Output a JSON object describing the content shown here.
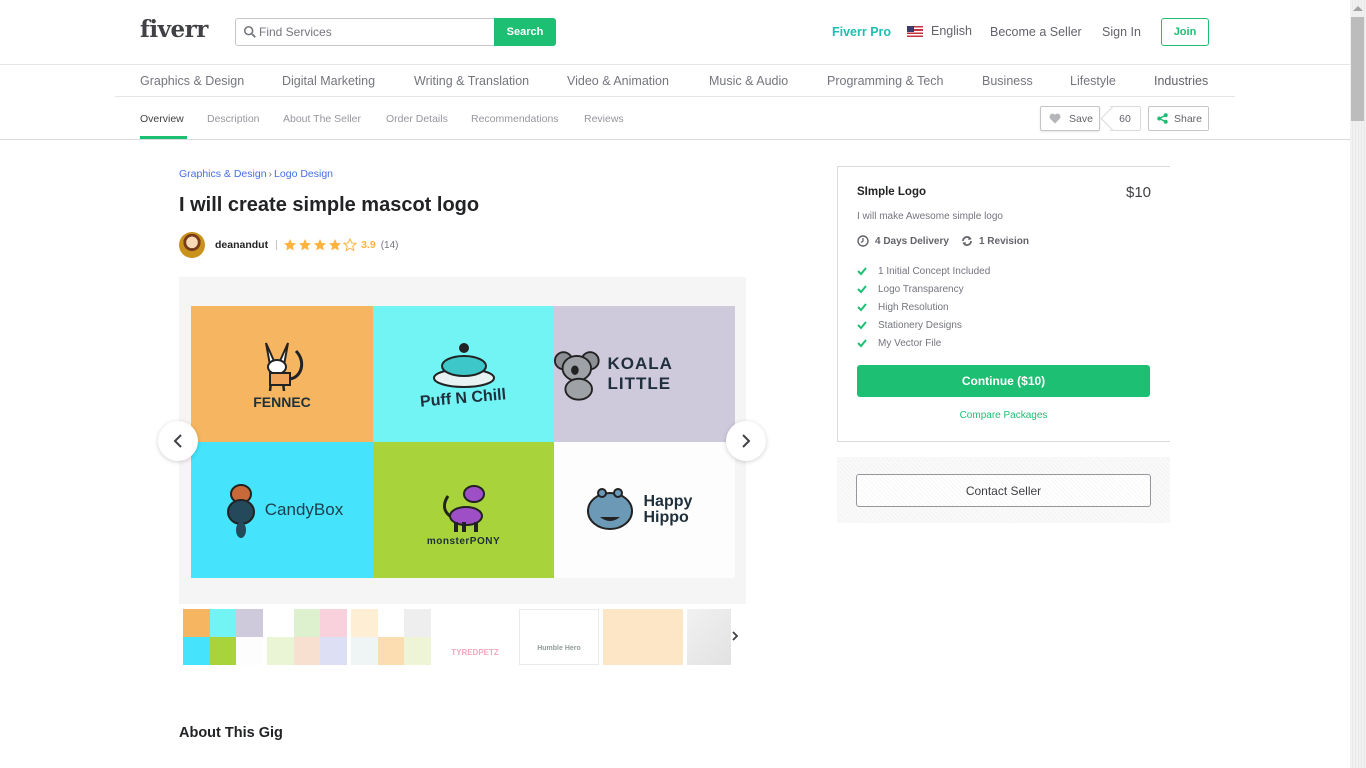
{
  "header": {
    "logo": "fiverr",
    "search_placeholder": "Find Services",
    "search_button": "Search",
    "pro_link": "Fiverr Pro",
    "language": "English",
    "become_seller": "Become a Seller",
    "sign_in": "Sign In",
    "join": "Join"
  },
  "categories": [
    "Graphics & Design",
    "Digital Marketing",
    "Writing & Translation",
    "Video & Animation",
    "Music & Audio",
    "Programming & Tech",
    "Business",
    "Lifestyle",
    "Industries"
  ],
  "subnav": {
    "tabs": [
      "Overview",
      "Description",
      "About The Seller",
      "Order Details",
      "Recommendations",
      "Reviews"
    ],
    "active_tab": "Overview",
    "save_label": "Save",
    "save_count": "60",
    "share_label": "Share"
  },
  "gig": {
    "breadcrumb": [
      "Graphics & Design",
      "Logo Design"
    ],
    "breadcrumb_separator": "›",
    "title": "I will create simple mascot logo",
    "seller": "deanandut",
    "rating": "3.9",
    "stars_filled": 4,
    "stars_total": 5,
    "review_count": "(14)"
  },
  "gallery": {
    "tiles": [
      {
        "label": "FENNEC",
        "bg": "#f6b661"
      },
      {
        "label": "Puff N Chill",
        "bg": "#73f4f4"
      },
      {
        "label": "KOALA LITTLE",
        "bg": "#cfc9dc"
      },
      {
        "label": "CandyBox",
        "bg": "#45e4fc"
      },
      {
        "label": "monsterPONY",
        "bg": "#a8d33a"
      },
      {
        "label": "Happy Hippo",
        "bg": "#fdfdfd"
      }
    ],
    "thumbnails": [
      "mascot-grid-1",
      "mascot-grid-2",
      "mascot-grid-3",
      "TYREDPETZ",
      "Humble Hero",
      "monguy",
      "sketch"
    ]
  },
  "package": {
    "name": "SImple Logo",
    "price": "$10",
    "description": "I will make Awesome simple logo",
    "delivery": "4 Days Delivery",
    "revisions": "1 Revision",
    "features": [
      "1 Initial Concept Included",
      "Logo Transparency",
      "High Resolution",
      "Stationery Designs",
      "My Vector File"
    ],
    "continue_button": "Continue ($10)",
    "compare_link": "Compare Packages",
    "contact_button": "Contact Seller"
  },
  "about_heading": "About This Gig",
  "colors": {
    "brand_green": "#1dbf73",
    "pro_teal": "#1dbfb2",
    "star_yellow": "#ffb33e",
    "link_blue": "#446ee7"
  }
}
